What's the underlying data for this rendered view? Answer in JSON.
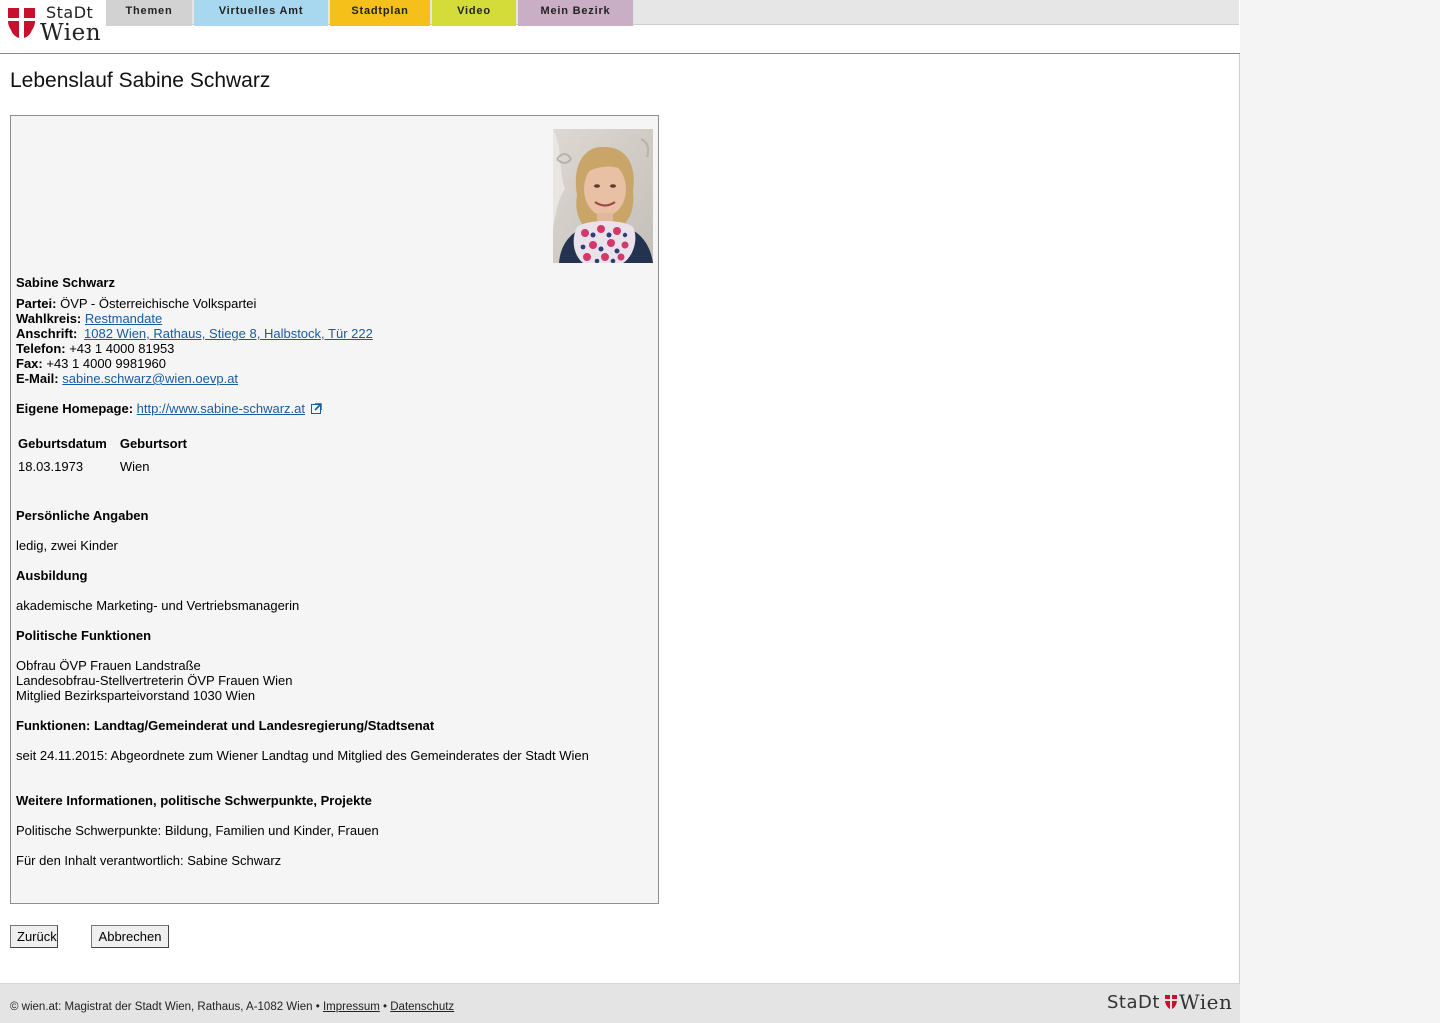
{
  "header": {
    "logo_top": "StaDt",
    "logo_bottom": "Wien",
    "nav": [
      {
        "label": "Themen",
        "color": "#d2d2d2"
      },
      {
        "label": "Virtuelles Amt",
        "color": "#a8d8f0"
      },
      {
        "label": "Stadtplan",
        "color": "#f5c01a"
      },
      {
        "label": "Video",
        "color": "#d4dc3a"
      },
      {
        "label": "Mein Bezirk",
        "color": "#c9aec6"
      }
    ]
  },
  "page": {
    "title": "Lebenslauf Sabine Schwarz"
  },
  "profile": {
    "name": "Sabine Schwarz",
    "partei_label": "Partei:",
    "partei": "ÖVP - Österreichische Volkspartei",
    "wahlkreis_label": "Wahlkreis:",
    "wahlkreis": "Restmandate",
    "anschrift_label": "Anschrift:",
    "anschrift": "1082 Wien, Rathaus, Stiege 8, Halbstock, Tür 222",
    "telefon_label": "Telefon:",
    "telefon": "+43 1 4000 81953",
    "fax_label": "Fax:",
    "fax": "+43 1 4000 9981960",
    "email_label": "E-Mail:",
    "email": "sabine.schwarz@wien.oevp.at",
    "homepage_label": "Eigene Homepage:",
    "homepage": "http://www.sabine-schwarz.at",
    "birth_table": {
      "headers": [
        "Geburtsdatum",
        "Geburtsort"
      ],
      "row": [
        "18.03.1973",
        "Wien"
      ]
    },
    "sections": {
      "persoenlich_head": "Persönliche Angaben",
      "persoenlich": "ledig, zwei Kinder",
      "ausbildung_head": "Ausbildung",
      "ausbildung": "akademische Marketing- und Vertriebsmanagerin",
      "politisch_head": "Politische Funktionen",
      "politisch": [
        "Obfrau ÖVP Frauen Landstraße",
        "Landesobfrau-Stellvertreterin ÖVP Frauen Wien",
        "Mitglied Bezirksparteivorstand 1030 Wien"
      ],
      "funktionen_head": "Funktionen: Landtag/Gemeinderat und Landesregierung/Stadtsenat",
      "funktionen": "seit 24.11.2015: Abgeordnete zum Wiener Landtag und Mitglied des Gemeinderates der Stadt Wien",
      "weitere_head": "Weitere Informationen, politische Schwerpunkte, Projekte",
      "weitere": "Politische Schwerpunkte: Bildung, Familien und Kinder, Frauen",
      "verantwortlich": "Für den Inhalt verantwortlich: Sabine Schwarz"
    }
  },
  "buttons": {
    "back": "Zurück",
    "cancel": "Abbrechen"
  },
  "footer": {
    "text": "© wien.at: Magistrat der Stadt Wien, Rathaus, A-1082 Wien •",
    "impressum": "Impressum",
    "separator": "•",
    "datenschutz": "Datenschutz",
    "logo_left": "StaDt",
    "logo_right": "Wien"
  }
}
